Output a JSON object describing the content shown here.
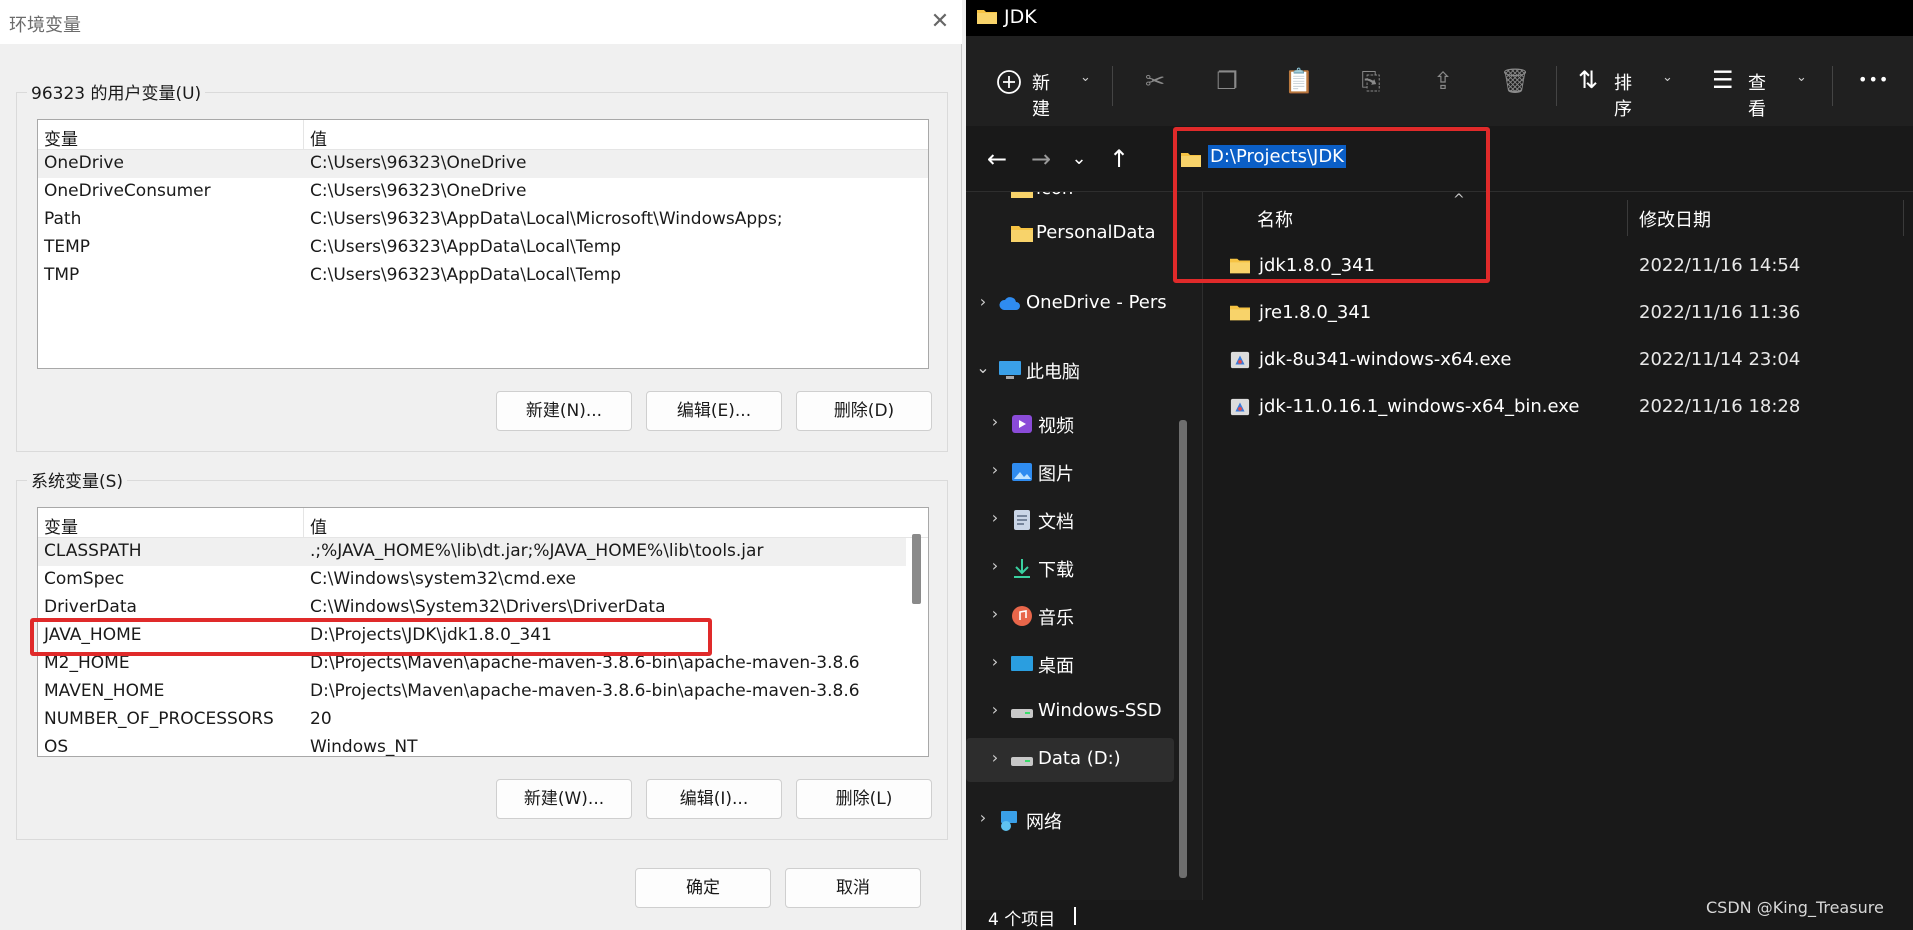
{
  "env_dialog": {
    "title": "环境变量",
    "close_glyph": "✕",
    "user_group_label": "96323 的用户变量(U)",
    "user_columns": [
      "变量",
      "值"
    ],
    "user_vars": [
      {
        "name": "OneDrive",
        "value": "C:\\Users\\96323\\OneDrive"
      },
      {
        "name": "OneDriveConsumer",
        "value": "C:\\Users\\96323\\OneDrive"
      },
      {
        "name": "Path",
        "value": "C:\\Users\\96323\\AppData\\Local\\Microsoft\\WindowsApps;"
      },
      {
        "name": "TEMP",
        "value": "C:\\Users\\96323\\AppData\\Local\\Temp"
      },
      {
        "name": "TMP",
        "value": "C:\\Users\\96323\\AppData\\Local\\Temp"
      }
    ],
    "user_buttons": {
      "new": "新建(N)...",
      "edit": "编辑(E)...",
      "delete": "删除(D)"
    },
    "sys_group_label": "系统变量(S)",
    "sys_columns": [
      "变量",
      "值"
    ],
    "sys_vars": [
      {
        "name": "CLASSPATH",
        "value": ".;%JAVA_HOME%\\lib\\dt.jar;%JAVA_HOME%\\lib\\tools.jar"
      },
      {
        "name": "ComSpec",
        "value": "C:\\Windows\\system32\\cmd.exe"
      },
      {
        "name": "DriverData",
        "value": "C:\\Windows\\System32\\Drivers\\DriverData"
      },
      {
        "name": "JAVA_HOME",
        "value": "D:\\Projects\\JDK\\jdk1.8.0_341"
      },
      {
        "name": "M2_HOME",
        "value": "D:\\Projects\\Maven\\apache-maven-3.8.6-bin\\apache-maven-3.8.6"
      },
      {
        "name": "MAVEN_HOME",
        "value": "D:\\Projects\\Maven\\apache-maven-3.8.6-bin\\apache-maven-3.8.6"
      },
      {
        "name": "NUMBER_OF_PROCESSORS",
        "value": "20"
      },
      {
        "name": "OS",
        "value": "Windows_NT"
      }
    ],
    "sys_buttons": {
      "new": "新建(W)...",
      "edit": "编辑(I)...",
      "delete": "删除(L)"
    },
    "ok": "确定",
    "cancel": "取消"
  },
  "explorer": {
    "title": "JDK",
    "toolbar": {
      "new": "新建",
      "sort": "排序",
      "view": "查看",
      "more": "•••"
    },
    "address": "D:\\Projects\\JDK",
    "nav_items": [
      {
        "label": "icon",
        "icon": "folder-icon"
      },
      {
        "label": "PersonalData",
        "icon": "folder-icon"
      },
      {
        "label": "OneDrive - Pers",
        "icon": "cloud-icon"
      },
      {
        "label": "此电脑",
        "icon": "computer-icon"
      },
      {
        "label": "视频",
        "icon": "video-icon"
      },
      {
        "label": "图片",
        "icon": "picture-icon"
      },
      {
        "label": "文档",
        "icon": "document-icon"
      },
      {
        "label": "下载",
        "icon": "download-icon"
      },
      {
        "label": "音乐",
        "icon": "music-icon"
      },
      {
        "label": "桌面",
        "icon": "desktop-icon"
      },
      {
        "label": "Windows-SSD",
        "icon": "drive-icon"
      },
      {
        "label": "Data (D:)",
        "icon": "drive-icon"
      },
      {
        "label": "网络",
        "icon": "network-icon"
      }
    ],
    "columns": {
      "name": "名称",
      "date": "修改日期"
    },
    "files": [
      {
        "name": "jdk1.8.0_341",
        "date": "2022/11/16 14:54",
        "icon": "folder-icon"
      },
      {
        "name": "jre1.8.0_341",
        "date": "2022/11/16 11:36",
        "icon": "folder-icon"
      },
      {
        "name": "jdk-8u341-windows-x64.exe",
        "date": "2022/11/14 23:04",
        "icon": "installer-icon"
      },
      {
        "name": "jdk-11.0.16.1_windows-x64_bin.exe",
        "date": "2022/11/16 18:28",
        "icon": "installer-icon"
      }
    ],
    "status": "4 个项目"
  },
  "watermark": "CSDN @King_Treasure",
  "colors": {
    "highlight_box": "#e02a2a",
    "selection_blue": "#0b5fc7",
    "folder_yellow": "#f6c343"
  }
}
